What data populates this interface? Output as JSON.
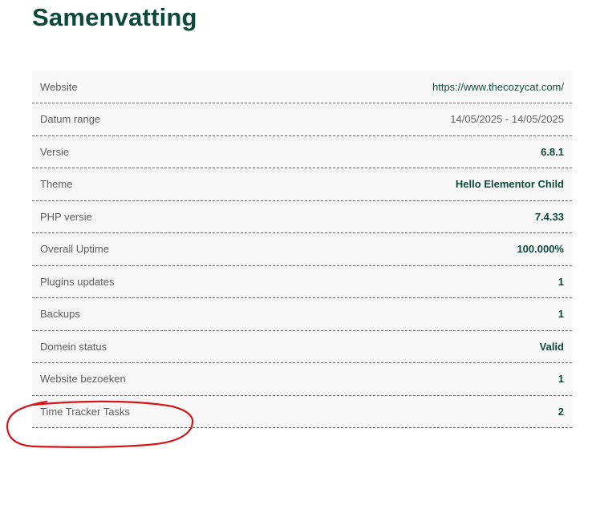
{
  "page": {
    "title": "Samenvatting"
  },
  "summary": {
    "rows": [
      {
        "label": "Website",
        "value": "https://www.thecozycat.com/"
      },
      {
        "label": "Datum range",
        "value": "14/05/2025 - 14/05/2025"
      },
      {
        "label": "Versie",
        "value": "6.8.1"
      },
      {
        "label": "Theme",
        "value": "Hello Elementor Child"
      },
      {
        "label": "PHP versie",
        "value": "7.4.33"
      },
      {
        "label": "Overall Uptime",
        "value": "100.000%"
      },
      {
        "label": "Plugins updates",
        "value": "1"
      },
      {
        "label": "Backups",
        "value": "1"
      },
      {
        "label": "Domein status",
        "value": "Valid"
      },
      {
        "label": "Website bezoeken",
        "value": "1"
      },
      {
        "label": "Time Tracker Tasks",
        "value": "2"
      }
    ]
  },
  "colors": {
    "heading": "#0b4a3a",
    "annotation": "#d4161b"
  }
}
